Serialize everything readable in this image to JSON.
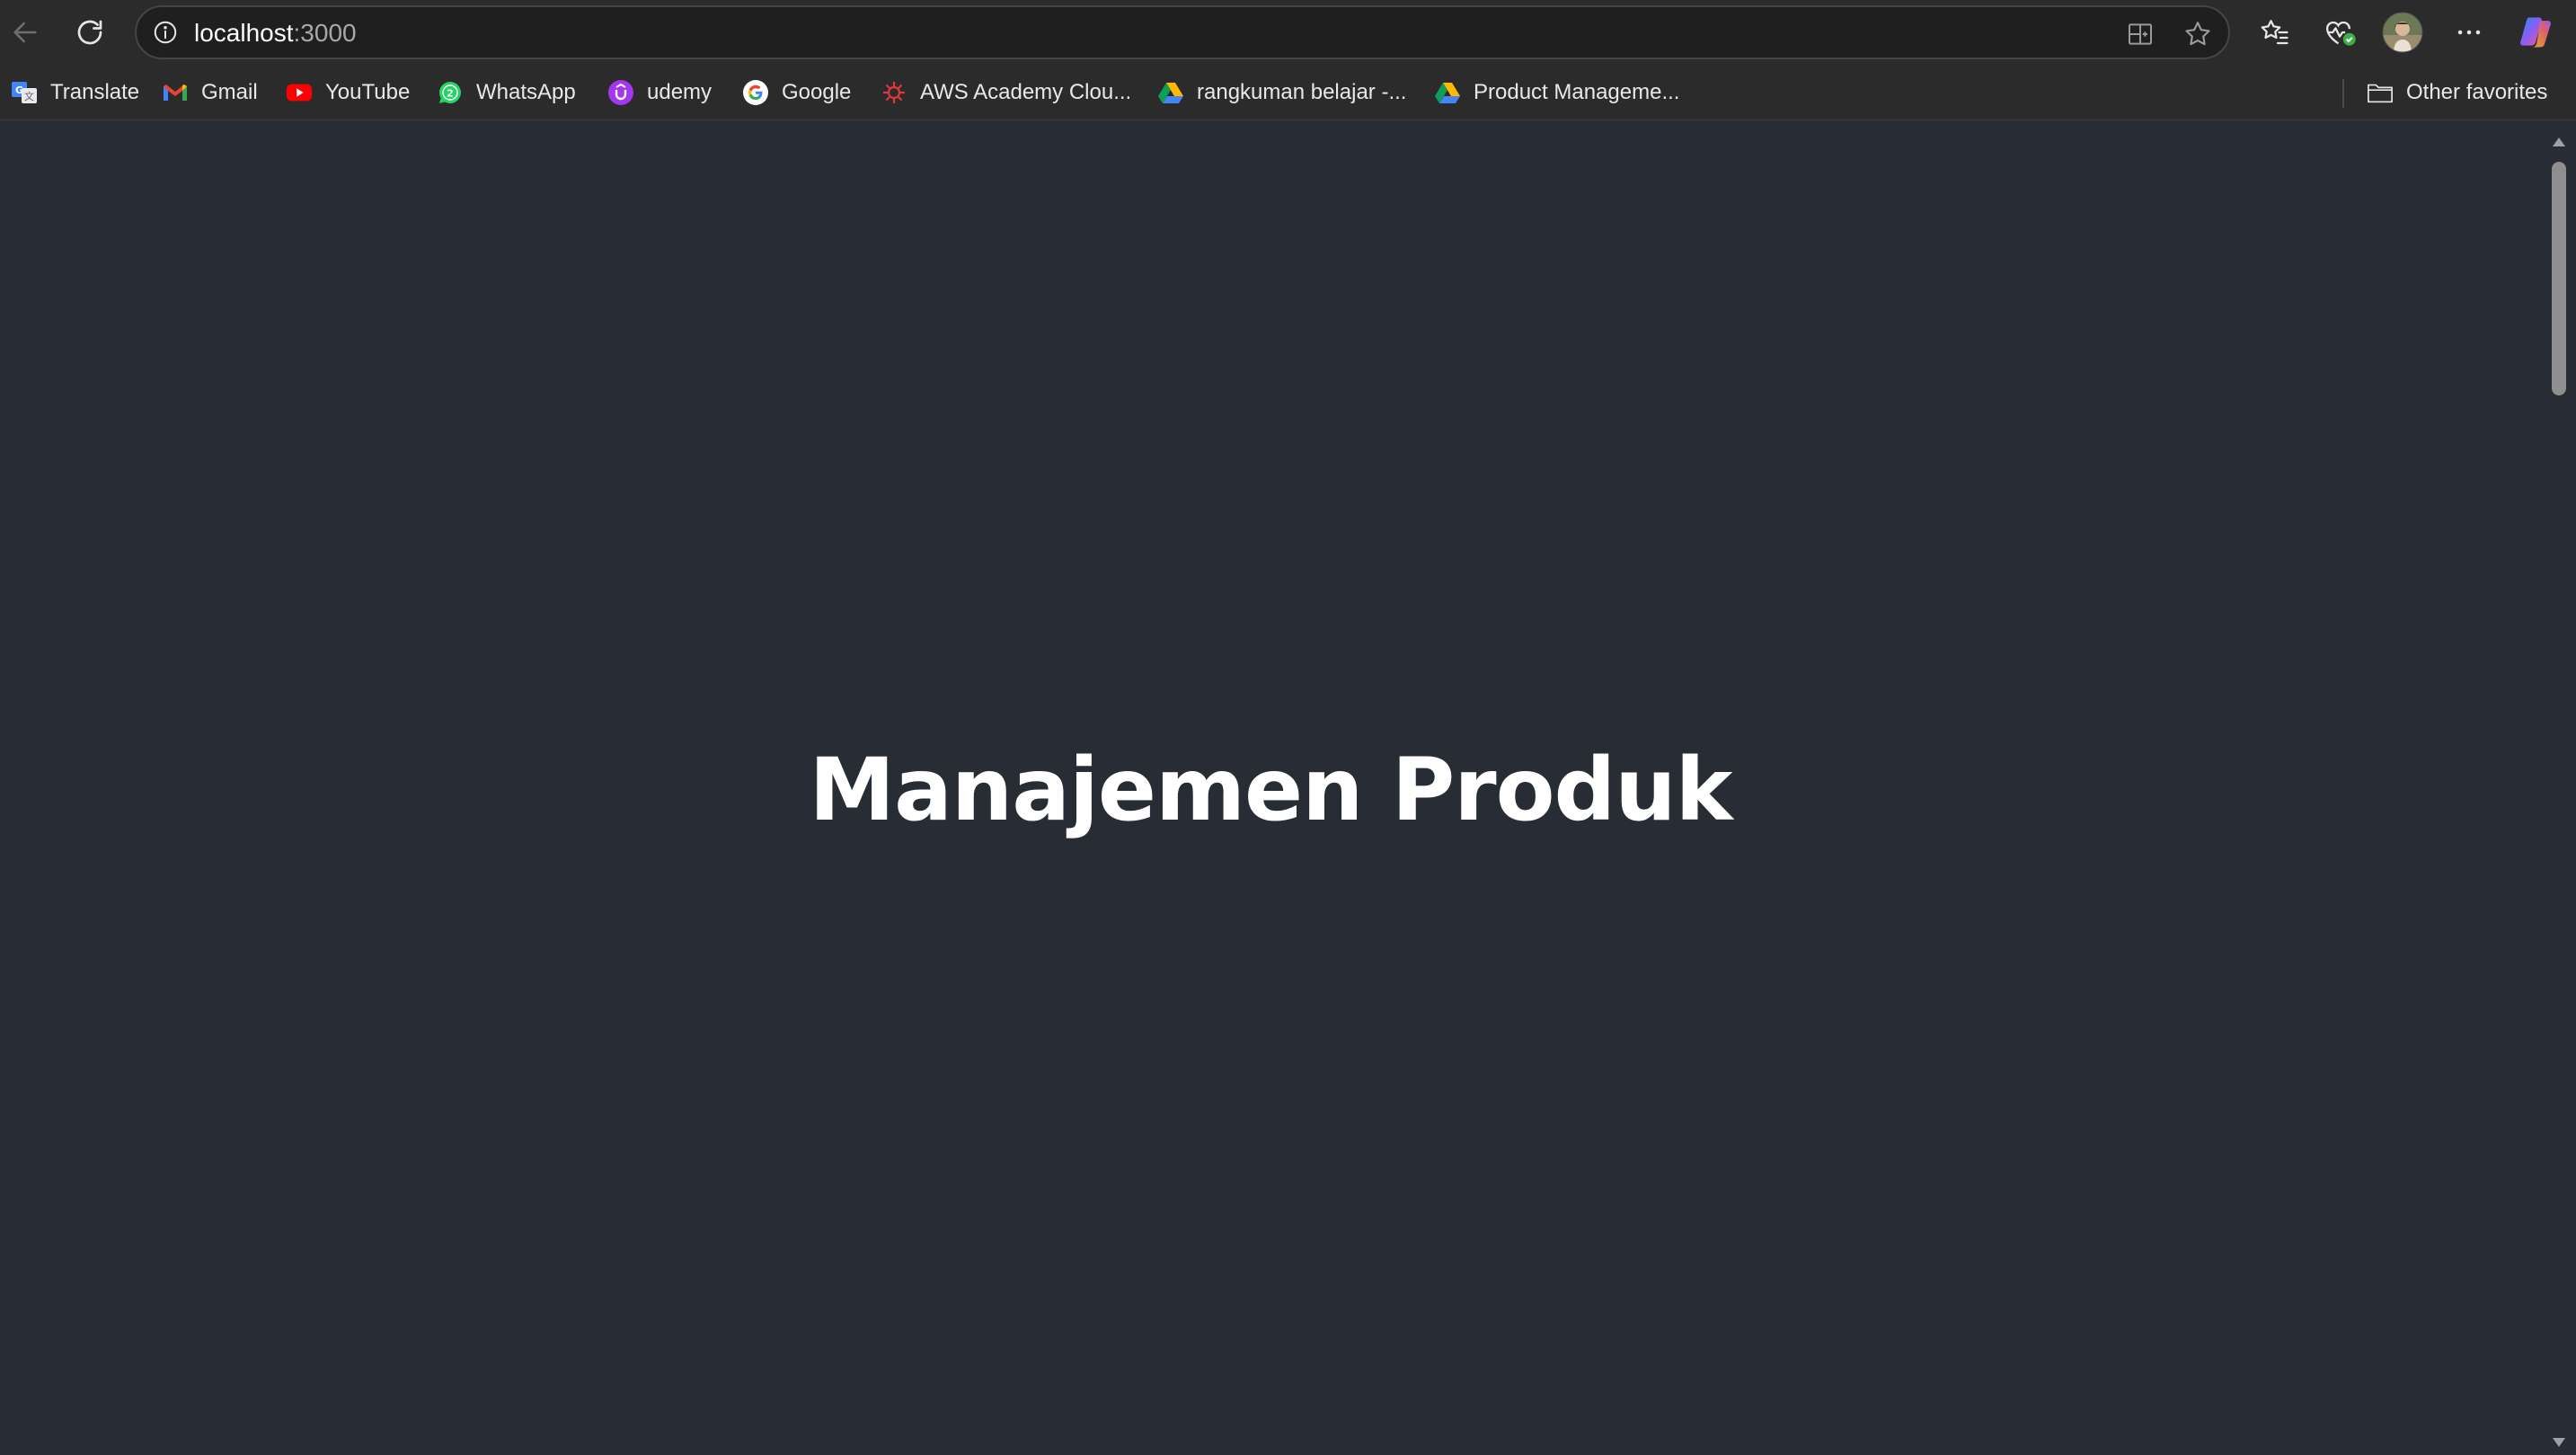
{
  "browser": {
    "address": {
      "host": "localhost",
      "port": ":3000"
    },
    "toolbar_icons": [
      "back-icon",
      "refresh-icon",
      "site-info-icon",
      "split-screen-icon",
      "favorite-star-icon",
      "favorites-list-icon",
      "browser-essentials-icon",
      "profile-avatar",
      "more-options-icon",
      "copilot-icon"
    ],
    "bookmarks": [
      {
        "label": "Translate",
        "icon": "translate-icon"
      },
      {
        "label": "Gmail",
        "icon": "gmail-icon"
      },
      {
        "label": "YouTube",
        "icon": "youtube-icon"
      },
      {
        "label": "WhatsApp",
        "icon": "whatsapp-icon"
      },
      {
        "label": "udemy",
        "icon": "udemy-icon"
      },
      {
        "label": "Google",
        "icon": "google-icon"
      },
      {
        "label": "AWS Academy Clou...",
        "icon": "aws-academy-icon"
      },
      {
        "label": "rangkuman belajar -...",
        "icon": "google-drive-icon"
      },
      {
        "label": "Product Manageme...",
        "icon": "google-drive-icon"
      }
    ],
    "other_favorites": {
      "label": "Other favorites",
      "icon": "folder-icon"
    }
  },
  "page": {
    "title": "Manajemen Produk",
    "background_color": "#282c34",
    "text_color": "#ffffff"
  }
}
